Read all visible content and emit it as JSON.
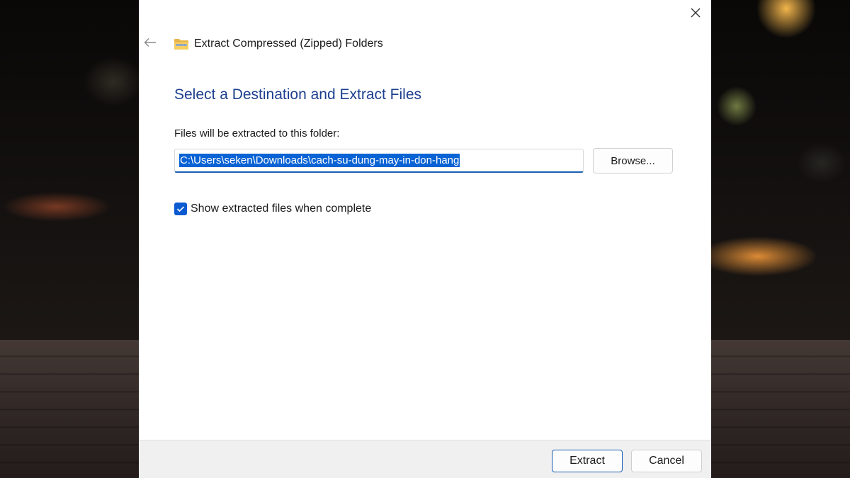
{
  "dialog": {
    "title": "Extract Compressed (Zipped) Folders",
    "heading": "Select a Destination and Extract Files",
    "destination_label": "Files will be extracted to this folder:",
    "destination_path": "C:\\Users\\seken\\Downloads\\cach-su-dung-may-in-don-hang",
    "browse_label": "Browse...",
    "show_files_label": "Show extracted files when complete",
    "show_files_checked": true,
    "extract_label": "Extract",
    "cancel_label": "Cancel"
  },
  "icons": {
    "close": "close-icon",
    "back": "back-arrow-icon",
    "title": "zip-folder-icon",
    "checkbox": "checkmark-icon"
  },
  "colors": {
    "accent": "#0a63d4",
    "heading": "#1d3f8f",
    "footer": "#f0f0f0"
  }
}
